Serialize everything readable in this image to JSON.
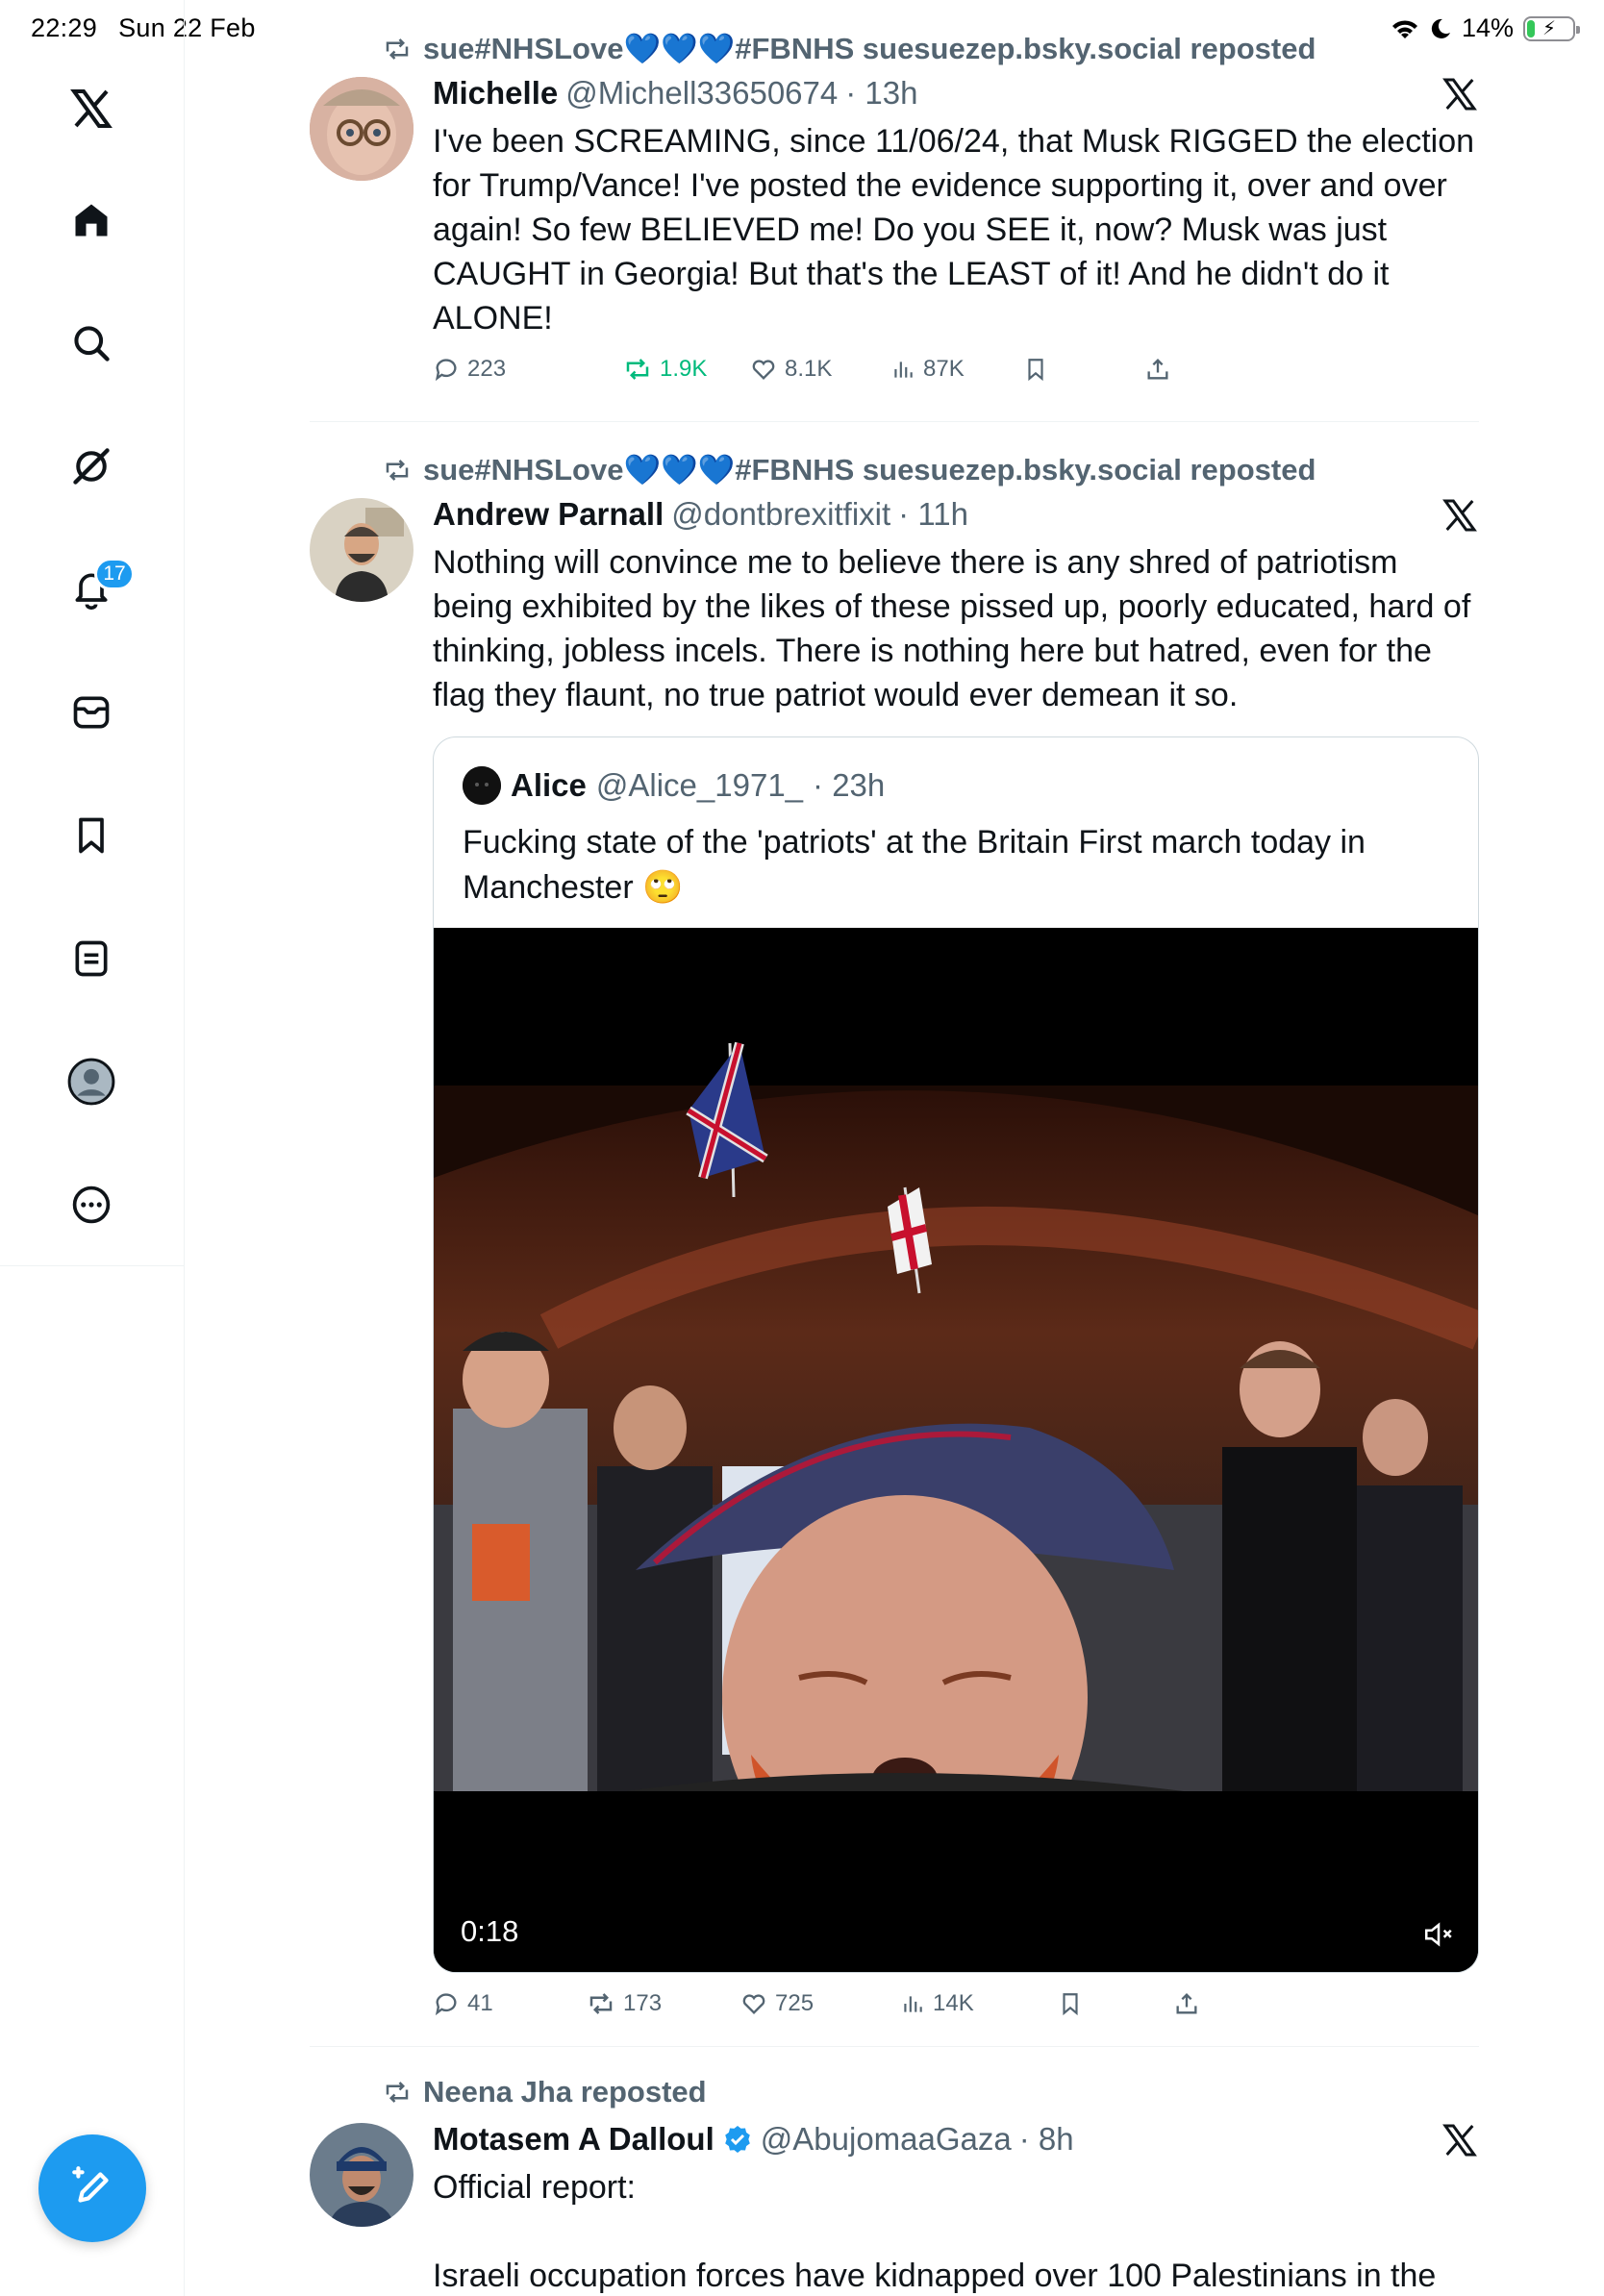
{
  "status_bar": {
    "time": "22:29",
    "date": "Sun 22 Feb",
    "battery": "14%"
  },
  "sidebar": {
    "notification_count": "17"
  },
  "tweets": [
    {
      "repost_by": "sue#NHSLove💙💙💙#FBNHS suesuezep.bsky.social reposted",
      "name": "Michelle",
      "handle": "@Michell33650674",
      "time": "· 13h",
      "lines": [
        "I've been SCREAMING, since 11/06/24, that Musk RIGGED the election",
        "for Trump/Vance!  I've posted the evidence supporting it, over and over",
        "again!  So few BELIEVED me!  Do you SEE it, now?  Musk was just",
        "CAUGHT in Georgia!  But that's the LEAST of it!  And he didn't do it",
        "ALONE!"
      ],
      "replies": "223",
      "reposts": "1.9K",
      "likes": "8.1K",
      "views": "87K"
    },
    {
      "repost_by": "sue#NHSLove💙💙💙#FBNHS suesuezep.bsky.social reposted",
      "name": "Andrew Parnall",
      "handle": "@dontbrexitfixit",
      "time": "· 11h",
      "lines": [
        "Nothing will convince me to believe there is any shred of patriotism",
        "being exhibited by the likes of these pissed up, poorly educated, hard of",
        "thinking, jobless incels. There is nothing here but hatred, even for the",
        "flag they flaunt, no true patriot would ever demean it so."
      ],
      "quote": {
        "name": "Alice",
        "handle": "@Alice_1971_",
        "time": "· 23h",
        "lines": [
          "Fucking state of the 'patriots' at the Britain First march today in",
          "Manchester 🙄"
        ],
        "video_duration": "0:18"
      },
      "replies": "41",
      "reposts": "173",
      "likes": "725",
      "views": "14K"
    },
    {
      "repost_by": "Neena Jha reposted",
      "name": "Motasem A Dalloul",
      "handle": "@AbujomaaGaza",
      "time": "· 8h",
      "lines": [
        "Official report:",
        "",
        "Israeli occupation forces have kidnapped over 100 Palestinians in the"
      ]
    }
  ],
  "colors": {
    "accent": "#1d9bf0",
    "repost_green": "#00ba7c",
    "muted": "#536471"
  }
}
